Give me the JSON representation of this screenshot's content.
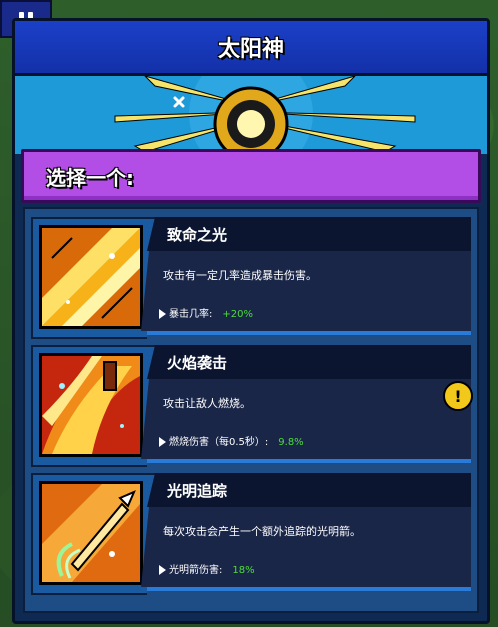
{
  "title": "太阳神",
  "choose_prompt": "选择一个:",
  "colors": {
    "title_bar": "#1b40c8",
    "choose_bar": "#b24de6",
    "stat_value": "#4cdc3a",
    "alert": "#f2c81a"
  },
  "cards": [
    {
      "title": "致命之光",
      "description": "攻击有一定几率造成暴击伤害。",
      "stat_label": "暴击几率:",
      "stat_value": "+20%",
      "icon": "deadly-light-icon",
      "has_alert": false
    },
    {
      "title": "火焰袭击",
      "description": "攻击让敌人燃烧。",
      "stat_label": "燃烧伤害（每0.5秒）:",
      "stat_value": "9.8%",
      "icon": "flame-strike-icon",
      "has_alert": true
    },
    {
      "title": "光明追踪",
      "description": "每次攻击会产生一个额外追踪的光明箭。",
      "stat_label": "光明箭伤害:",
      "stat_value": "18%",
      "icon": "light-tracking-icon",
      "has_alert": false
    }
  ],
  "alert_symbol": "!"
}
